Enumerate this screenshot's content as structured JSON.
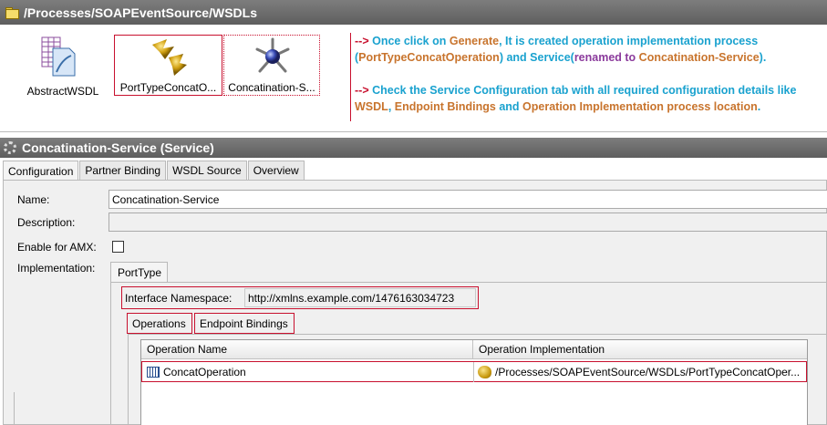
{
  "path_bar": {
    "title": "/Processes/SOAPEventSource/WSDLs"
  },
  "resources": [
    {
      "label": "AbstractWSDL",
      "icon": "wsdl-document-icon"
    },
    {
      "label": "PortTypeConcatO...",
      "icon": "process-gears-icon"
    },
    {
      "label": "Concatination-S...",
      "icon": "service-node-icon"
    }
  ],
  "annotation": {
    "line1": {
      "arrow": "-->",
      "t1": " Once click on ",
      "t2": "Generate",
      "t3": ", It is created operation implementation process (",
      "t4": "PortTypeConcatOperation",
      "t5": ") and Service(",
      "t6": "renamed to ",
      "t7": "Concatination-Service",
      "t8": ")."
    },
    "line2": {
      "arrow": "-->",
      "t1": " Check the Service Configuration tab with all required configuration details like ",
      "t2": "WSDL",
      "t3": ", ",
      "t4": "Endpoint Bindings",
      "t5": " and ",
      "t6": "Operation Implementation process location",
      "t7": "."
    }
  },
  "service_bar": {
    "title": "Concatination-Service (Service)"
  },
  "tabs": [
    "Configuration",
    "Partner Binding",
    "WSDL Source",
    "Overview"
  ],
  "form": {
    "name_label": "Name:",
    "name_value": "Concatination-Service",
    "description_label": "Description:",
    "description_value": "",
    "amx_label": "Enable for AMX:",
    "amx_checked": false,
    "implementation_label": "Implementation:"
  },
  "implementation": {
    "tab": "PortType",
    "namespace_label": "Interface Namespace:",
    "namespace_value": "http://xmlns.example.com/1476163034723",
    "sub_tabs": [
      "Operations",
      "Endpoint Bindings"
    ],
    "table": {
      "headers": [
        "Operation Name",
        "Operation Implementation"
      ],
      "rows": [
        {
          "name": "ConcatOperation",
          "implementation": "/Processes/SOAPEventSource/WSDLs/PortTypeConcatOper..."
        }
      ]
    }
  },
  "colors": {
    "bar_gray": "#6e6e6e",
    "annotation_blue": "#1aa2cf",
    "annotation_orange": "#c8742d",
    "annotation_purple": "#8b3a9c",
    "highlight_red": "#c8102e"
  }
}
